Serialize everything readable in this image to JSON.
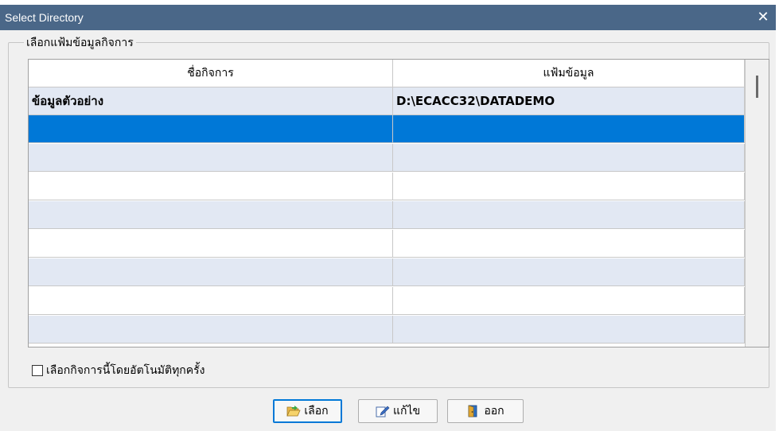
{
  "window": {
    "title": "Select Directory",
    "close_symbol": "✕"
  },
  "group": {
    "label": "เลือกแฟ้มข้อมูลกิจการ"
  },
  "table": {
    "columns": [
      "ชื่อกิจการ",
      "แฟ้มข้อมูล"
    ],
    "rows": [
      {
        "name": "ข้อมูลตัวอย่าง",
        "path": "D:\\ECACC32\\DATADEMO"
      },
      {
        "name": "",
        "path": ""
      },
      {
        "name": "",
        "path": ""
      },
      {
        "name": "",
        "path": ""
      },
      {
        "name": "",
        "path": ""
      },
      {
        "name": "",
        "path": ""
      },
      {
        "name": "",
        "path": ""
      },
      {
        "name": "",
        "path": ""
      },
      {
        "name": "",
        "path": ""
      }
    ],
    "selected_row": 1
  },
  "auto_select": {
    "label": "เลือกกิจการนี้โดยอัตโนมัติทุกครั้ง",
    "checked": false
  },
  "buttons": {
    "select": {
      "label": "เลือก",
      "icon": "folder-open-icon"
    },
    "edit": {
      "label": "แก้ไข",
      "icon": "edit-icon"
    },
    "exit": {
      "label": "ออก",
      "icon": "exit-door-icon"
    }
  },
  "colors": {
    "titlebar": "#4a6788",
    "selection": "#0078d7",
    "alt_row": "#e2e8f3"
  }
}
